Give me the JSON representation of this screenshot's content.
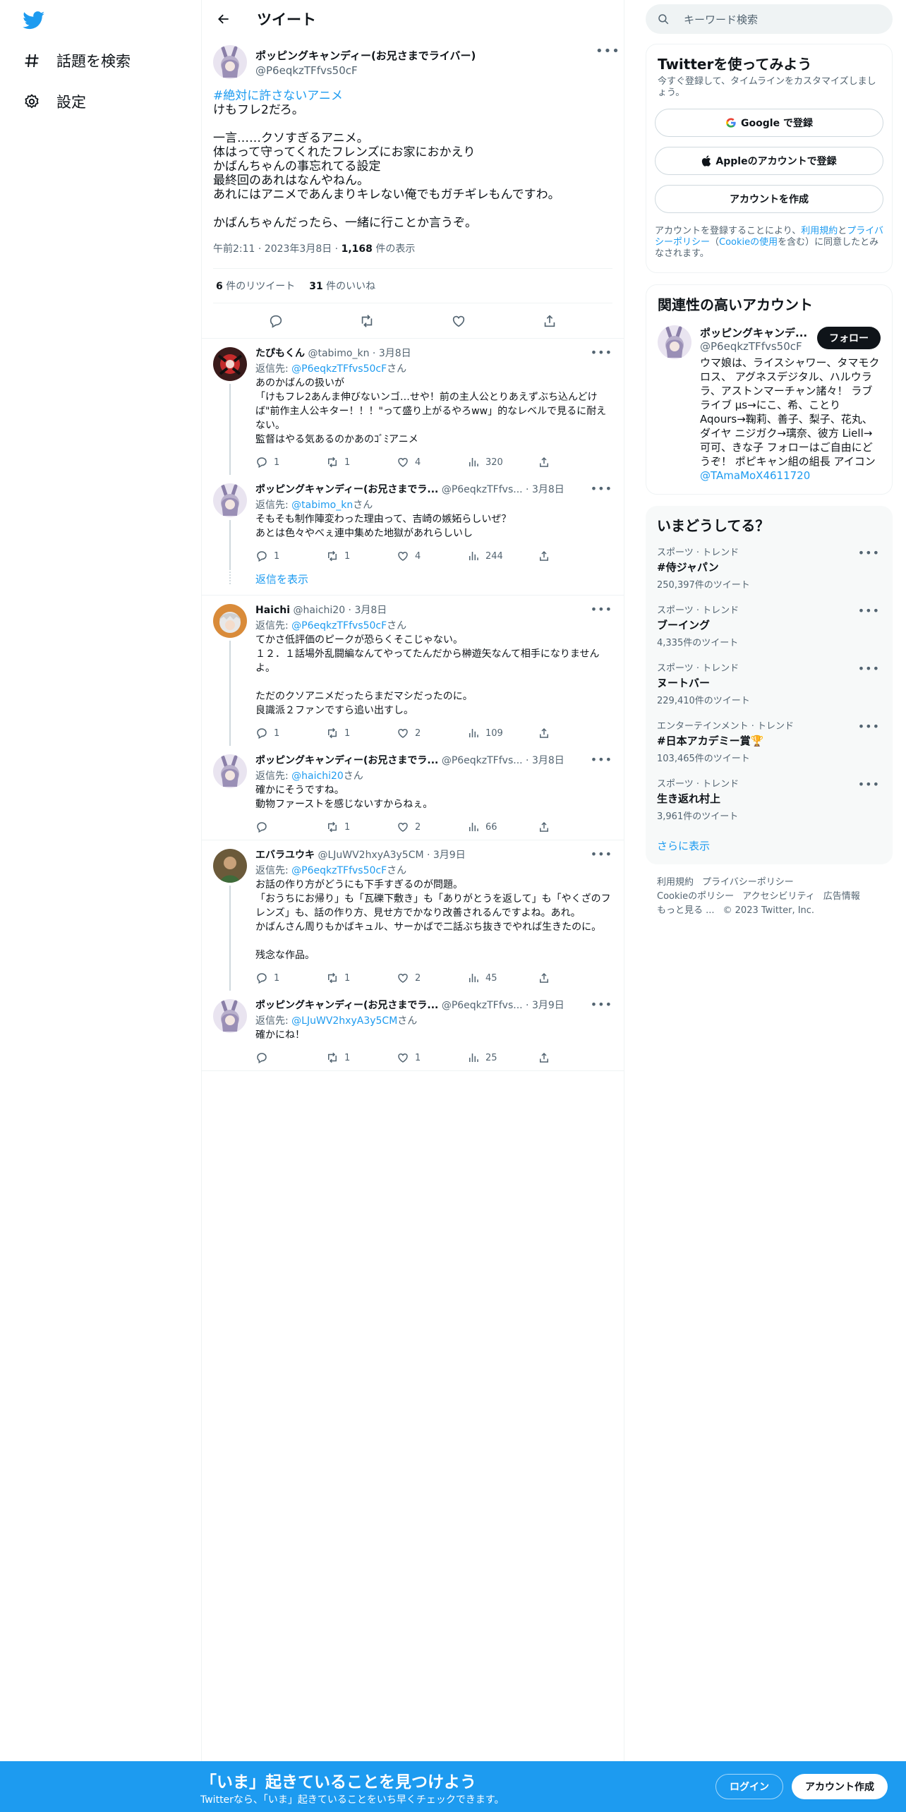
{
  "nav": {
    "explore_label": "話題を検索",
    "settings_label": "設定"
  },
  "header": {
    "title": "ツイート"
  },
  "main_tweet": {
    "name": "ポッピングキャンディー(お兄さまでライバー)",
    "handle": "@P6eqkzTFfvs50cF",
    "hashtag": "#絶対に許さないアニメ",
    "text": "けもフレ2だろ。\n\n一言……クソすぎるアニメ。\n体はって守ってくれたフレンズにお家におかえり\nかばんちゃんの事忘れてる設定\n最終回のあれはなんやねん。\nあれにはアニメであんまりキレない俺でもガチギレもんですわ。\n\nかばんちゃんだったら、一緒に行ことか言うぞ。",
    "time": "午前2:11 · 2023年3月8日 · ",
    "views_count": "1,168",
    "views_label": " 件の表示",
    "retweets_count": "6",
    "retweets_label": " 件のリツイート",
    "likes_count": "31",
    "likes_label": " 件のいいね"
  },
  "replies": [
    {
      "name": "たぴもくん",
      "meta": " @tabimo_kn · 3月8日",
      "to_label": "返信先: ",
      "to": "@P6eqkzTFfvs50cF",
      "to_suffix": "さん",
      "text": "あのかばんの扱いが\n「けもフレ2あんま伸びないンゴ…せや！前の主人公とりあえずぶち込んどけば\"前作主人公キター！！！\"って盛り上がるやろww」的なレベルで見るに耐えない。\n監督はやる気あるのかあのｺﾞﾐアニメ",
      "reply_count": "1",
      "rt_count": "1",
      "like_count": "4",
      "view_count": "320"
    },
    {
      "name": "ポッピングキャンディー(お兄さまでラ...",
      "meta": " @P6eqkzTFfvs... · 3月8日",
      "to_label": "返信先: ",
      "to": "@tabimo_kn",
      "to_suffix": "さん",
      "text": "そもそも制作陣変わった理由って、吉崎の嫉妬らしいぜ？\nあとは色々やべぇ連中集めた地獄があれらしいし",
      "reply_count": "1",
      "rt_count": "1",
      "like_count": "4",
      "view_count": "244"
    },
    {
      "name": "Haichi",
      "meta": " @haichi20 · 3月8日",
      "to_label": "返信先: ",
      "to": "@P6eqkzTFfvs50cF",
      "to_suffix": "さん",
      "text": "てかさ低評価のピークが恐らくそこじゃない。\n１２．１話場外乱闘編なんてやってたんだから榊遊矢なんて相手になりませんよ。\n\nただのクソアニメだったらまだマシだったのに。\n良識派２ファンですら追い出すし。",
      "reply_count": "1",
      "rt_count": "1",
      "like_count": "2",
      "view_count": "109"
    },
    {
      "name": "ポッピングキャンディー(お兄さまでラ...",
      "meta": " @P6eqkzTFfvs... · 3月8日",
      "to_label": "返信先: ",
      "to": "@haichi20",
      "to_suffix": "さん",
      "text": "確かにそうですね。\n動物ファーストを感じないすからねぇ。",
      "reply_count": "",
      "rt_count": "1",
      "like_count": "2",
      "view_count": "66"
    },
    {
      "name": "エバラユウキ",
      "meta": " @LJuWV2hxyA3y5CM · 3月9日",
      "to_label": "返信先: ",
      "to": "@P6eqkzTFfvs50cF",
      "to_suffix": "さん",
      "text": "お話の作り方がどうにも下手すぎるのが問題。\n「おうちにお帰り」も「瓦礫下敷き」も「ありがとうを返して」も「やくざのフレンズ」も、話の作り方、見せ方でかなり改善されるんですよね。あれ。\nかばんさん周りもかばキュル、サーかばで二話ぶち抜きでやれば生きたのに。\n\n残念な作品。",
      "reply_count": "1",
      "rt_count": "1",
      "like_count": "2",
      "view_count": "45"
    },
    {
      "name": "ポッピングキャンディー(お兄さまでラ...",
      "meta": " @P6eqkzTFfvs... · 3月9日",
      "to_label": "返信先: ",
      "to": "@LJuWV2hxyA3y5CM",
      "to_suffix": "さん",
      "text": "確かにね！",
      "reply_count": "",
      "rt_count": "1",
      "like_count": "1",
      "view_count": "25"
    }
  ],
  "show_replies_label": "返信を表示",
  "sidebar": {
    "search_placeholder": "キーワード検索",
    "signup": {
      "title": "Twitterを使ってみよう",
      "subtitle": "今すぐ登録して、タイムラインをカスタマイズしましょう。",
      "google_label": "Google で登録",
      "apple_label": "Appleのアカウントで登録",
      "create_label": "アカウントを作成",
      "legal_1": "アカウントを登録することにより、",
      "legal_terms": "利用規約",
      "legal_2": "と",
      "legal_privacy": "プライバシーポリシー",
      "legal_3": "（",
      "legal_cookie": "Cookieの使用",
      "legal_4": "を含む）に同意したとみなされます。"
    },
    "related": {
      "title": "関連性の高いアカウント",
      "name": "ポッピングキャンデ...",
      "handle": "@P6eqkzTFfvs50cF",
      "follow_label": "フォロー",
      "bio": "ウマ娘は、ライスシャワー、タマモクロス、 アグネスデジタル、ハルウララ、アストンマーチャン諸々！ ラブライブ μs→にこ、希、ことり Aqours→鞠莉、善子、梨子、花丸、ダイヤ ニジガク→璃奈、彼方 Liell→可可、きな子 フォローはご自由にどうぞ！ ポピキャン組の組長 アイコン",
      "bio_mention": "@TAmaMoX4611720"
    },
    "trends": {
      "title": "いまどうしてる？",
      "items": [
        {
          "category": "スポーツ · トレンド",
          "name": "#侍ジャパン",
          "count": "250,397件のツイート"
        },
        {
          "category": "スポーツ · トレンド",
          "name": "ブーイング",
          "count": "4,335件のツイート"
        },
        {
          "category": "スポーツ · トレンド",
          "name": "ヌートバー",
          "count": "229,410件のツイート"
        },
        {
          "category": "エンターテインメント · トレンド",
          "name": "#日本アカデミー賞🏆",
          "count": "103,465件のツイート"
        },
        {
          "category": "スポーツ · トレンド",
          "name": "生き返れ村上",
          "count": "3,961件のツイート"
        }
      ],
      "show_more": "さらに表示"
    },
    "footer": {
      "terms": "利用規約",
      "privacy": "プライバシーポリシー",
      "cookie": "Cookieのポリシー",
      "accessibility": "アクセシビリティ",
      "ads": "広告情報",
      "more": "もっと見る ...",
      "copyright": "© 2023 Twitter, Inc."
    }
  },
  "bottom_bar": {
    "title": "「いま」起きていることを見つけよう",
    "subtitle": "Twitterなら、「いま」起きていることをいち早くチェックできます。",
    "login_label": "ログイン",
    "signup_label": "アカウント作成"
  },
  "colors": {
    "accent": "#1d9bf0",
    "text": "#0f1419",
    "muted": "#536471"
  }
}
